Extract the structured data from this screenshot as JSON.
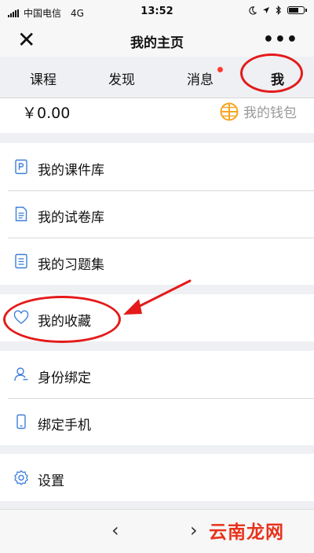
{
  "status_bar": {
    "carrier": "中国电信",
    "network": "4G",
    "time": "13:52",
    "battery_level": 0.75
  },
  "nav": {
    "close_glyph": "✕",
    "title": "我的主页",
    "more_glyph": "•••"
  },
  "tabs": [
    {
      "label": "课程"
    },
    {
      "label": "发现"
    },
    {
      "label": "消息",
      "badge": true
    },
    {
      "label": "我",
      "selected": true
    }
  ],
  "wallet": {
    "balance": "￥0.00",
    "label": "我的钱包",
    "icon": "wallet-grid-icon",
    "icon_color": "#f5a623"
  },
  "groups": [
    {
      "items": [
        {
          "label": "我的课件库",
          "icon": "courseware-icon"
        },
        {
          "label": "我的试卷库",
          "icon": "document-icon"
        },
        {
          "label": "我的习题集",
          "icon": "exercise-set-icon"
        }
      ]
    },
    {
      "items": [
        {
          "label": "我的收藏",
          "icon": "heart-icon"
        }
      ]
    },
    {
      "items": [
        {
          "label": "身份绑定",
          "icon": "person-icon"
        },
        {
          "label": "绑定手机",
          "icon": "phone-icon"
        }
      ]
    },
    {
      "items": [
        {
          "label": "设置",
          "icon": "gear-icon"
        }
      ]
    }
  ],
  "bottom": {
    "back_glyph": "‹",
    "forward_glyph": "›"
  },
  "watermark": "云南龙网",
  "colors": {
    "icon_blue": "#3d7fd9",
    "annotation_red": "#e41a1a",
    "badge_red": "#ff3b30",
    "background": "#eef0f3"
  }
}
